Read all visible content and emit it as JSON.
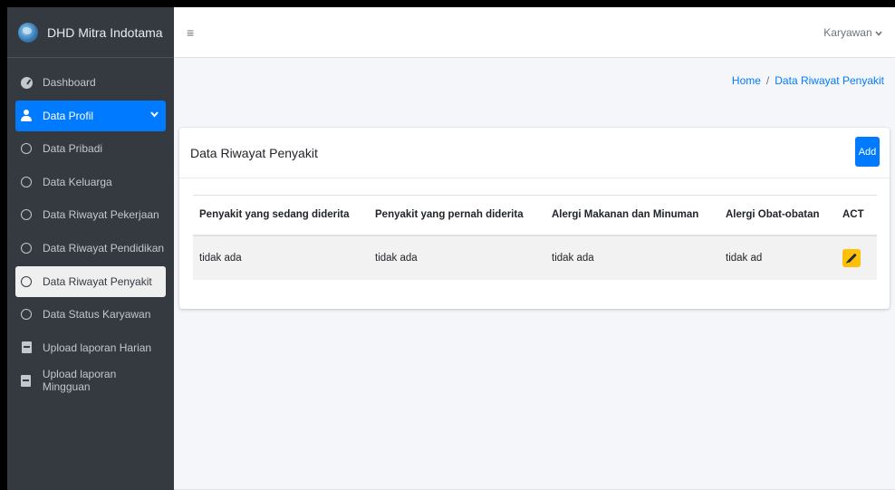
{
  "brand": {
    "name": "DHD Mitra Indotama",
    "logo_icon": "globe-logo"
  },
  "sidebar": {
    "items": [
      {
        "label": "Dashboard",
        "icon": "dashboard-icon",
        "state": "normal"
      },
      {
        "label": "Data Profil",
        "icon": "user-icon",
        "state": "active"
      },
      {
        "label": "Data Pribadi",
        "icon": "circle-icon",
        "state": "normal"
      },
      {
        "label": "Data Keluarga",
        "icon": "circle-icon",
        "state": "normal"
      },
      {
        "label": "Data Riwayat Pekerjaan",
        "icon": "circle-icon",
        "state": "normal"
      },
      {
        "label": "Data Riwayat Pendidikan",
        "icon": "circle-icon",
        "state": "normal"
      },
      {
        "label": "Data Riwayat Penyakit",
        "icon": "circle-icon",
        "state": "selected"
      },
      {
        "label": "Data Status Karyawan",
        "icon": "circle-icon",
        "state": "normal"
      },
      {
        "label": "Upload laporan Harian",
        "icon": "book-icon",
        "state": "normal"
      },
      {
        "label": "Upload laporan Mingguan",
        "icon": "book-icon",
        "state": "normal"
      }
    ]
  },
  "header": {
    "menu_icon": "≡",
    "user_label": "Karyawan",
    "user_chevron": "❯"
  },
  "breadcrumb": {
    "home": "Home",
    "separator": "/",
    "current": "Data Riwayat Penyakit"
  },
  "card": {
    "title": "Data Riwayat Penyakit",
    "add_label": "Add",
    "table": {
      "headers": [
        "Penyakit yang sedang diderita",
        "Penyakit yang pernah diderita",
        "Alergi Makanan dan Minuman",
        "Alergi Obat-obatan",
        "ACT"
      ],
      "rows": [
        [
          "tidak ada",
          "tidak ada",
          "tidak ada",
          "tidak ad"
        ]
      ]
    }
  },
  "colors": {
    "sidebar_bg": "#343a40",
    "primary": "#007bff",
    "warning": "#ffc107",
    "content_bg": "#f4f6f9"
  }
}
